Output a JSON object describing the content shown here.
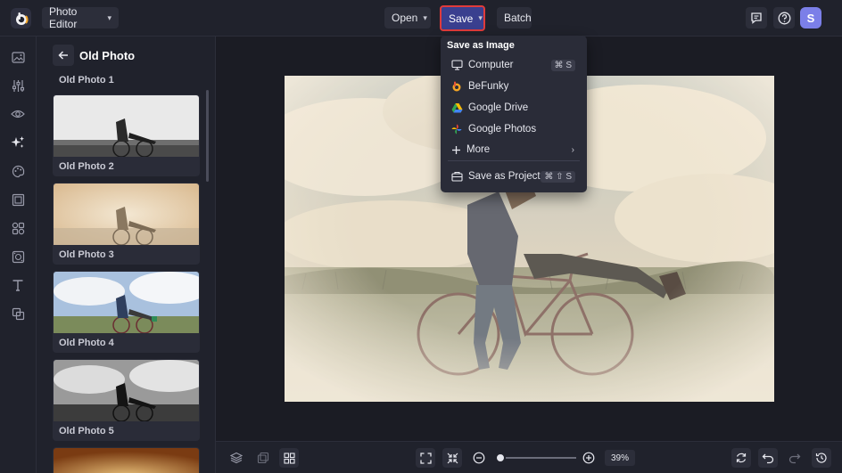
{
  "topbar": {
    "app_menu_label": "Photo Editor",
    "open_label": "Open",
    "save_label": "Save",
    "batch_label": "Batch",
    "avatar_initial": "S"
  },
  "panel": {
    "title": "Old Photo",
    "items": [
      {
        "label": "Old Photo 1"
      },
      {
        "label": "Old Photo 2"
      },
      {
        "label": "Old Photo 3"
      },
      {
        "label": "Old Photo 4"
      },
      {
        "label": "Old Photo 5"
      }
    ]
  },
  "save_menu": {
    "heading": "Save as Image",
    "items": [
      {
        "label": "Computer",
        "shortcut": "⌘ S",
        "icon": "monitor-icon"
      },
      {
        "label": "BeFunky",
        "icon": "befunky-icon"
      },
      {
        "label": "Google Drive",
        "icon": "google-drive-icon"
      },
      {
        "label": "Google Photos",
        "icon": "google-photos-icon"
      },
      {
        "label": "More",
        "icon": "plus-icon"
      },
      {
        "label": "Save as Project",
        "shortcut": "⌘ ⇧ S",
        "icon": "project-icon"
      }
    ]
  },
  "bottombar": {
    "zoom_value": "39%"
  },
  "colors": {
    "accent": "#3a3f8f",
    "highlight": "#e03b3b",
    "avatar": "#7b7fe8"
  }
}
